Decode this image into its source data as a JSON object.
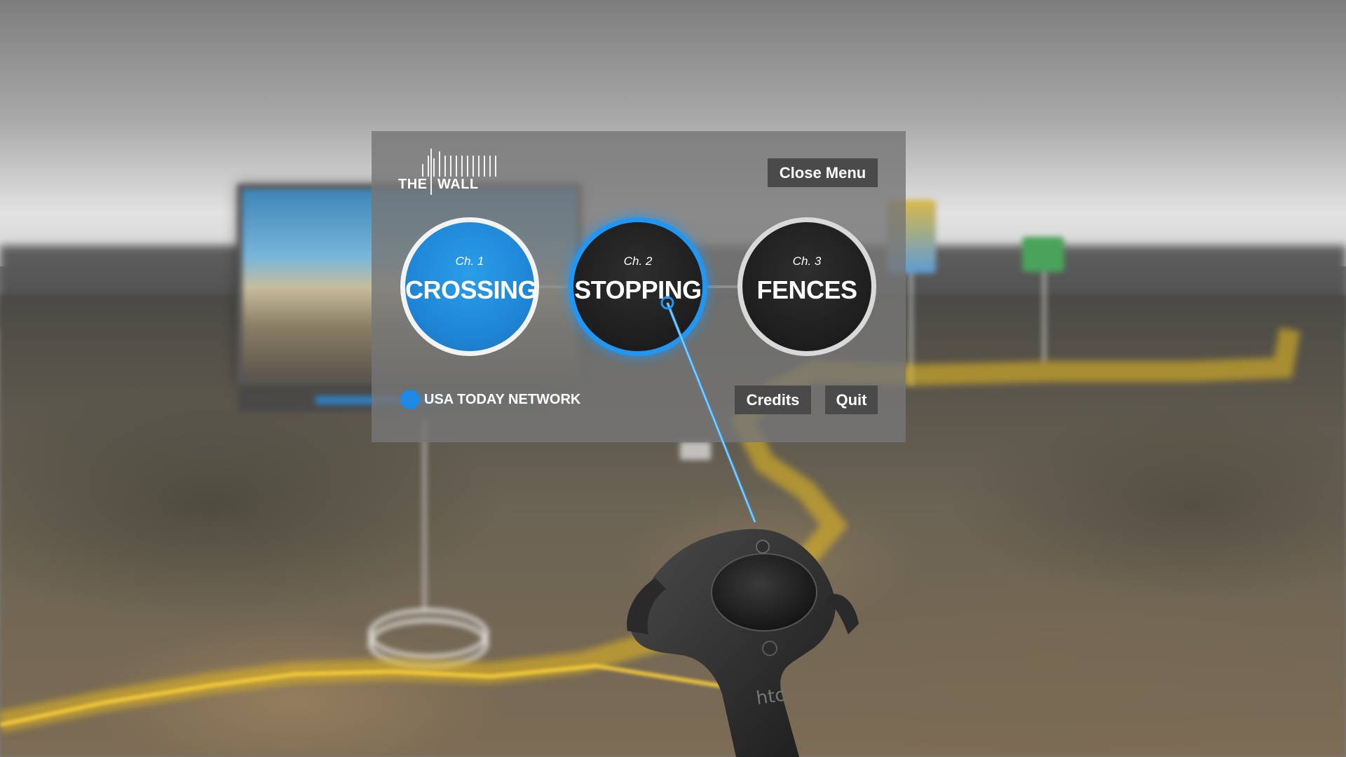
{
  "logo": {
    "the": "THE",
    "wall": "WALL"
  },
  "menu": {
    "close_label": "Close Menu",
    "credits_label": "Credits",
    "quit_label": "Quit"
  },
  "chapters": [
    {
      "number": "Ch. 1",
      "title": "CROSSING",
      "state": "completed"
    },
    {
      "number": "Ch. 2",
      "title": "STOPPING",
      "state": "hovered"
    },
    {
      "number": "Ch. 3",
      "title": "FENCES",
      "state": "upcoming"
    }
  ],
  "network": {
    "label": "USA TODAY NETWORK",
    "color": "#1e88e5"
  },
  "colors": {
    "accent": "#2196f3",
    "route": "#f2c230",
    "panel": "#767676",
    "button_bg": "#4a4a4a"
  },
  "icons": [
    "wall-logo-icon",
    "usa-today-dot-icon",
    "htc-vive-controller"
  ],
  "controller": {
    "brand": "htc"
  }
}
